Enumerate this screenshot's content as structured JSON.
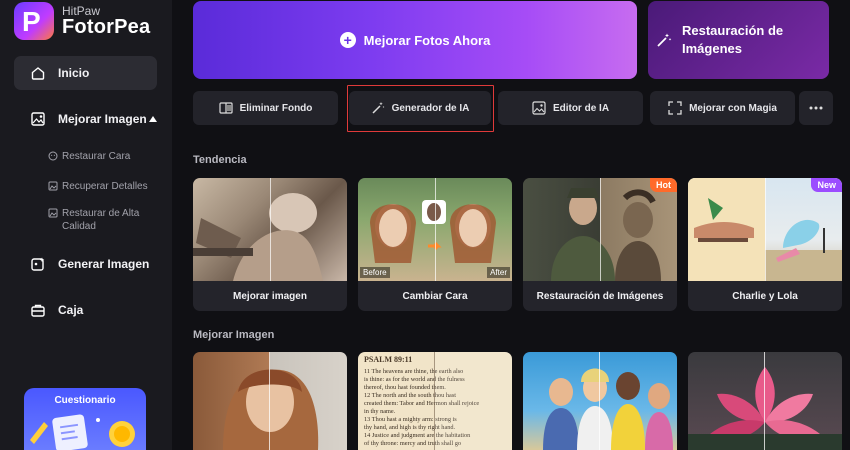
{
  "app": {
    "brand_top": "HitPaw",
    "brand_name": "FotorPea"
  },
  "sidebar": {
    "home": "Inicio",
    "enhance": "Mejorar Imagen",
    "enhance_sub": [
      "Restaurar Cara",
      "Recuperar Detalles",
      "Restaurar de Alta Calidad"
    ],
    "generate": "Generar Imagen",
    "box": "Caja",
    "promo": "Cuestionario"
  },
  "hero": {
    "enhance_now": "Mejorar Fotos Ahora",
    "restore": "Restauración de Imágenes"
  },
  "tools": [
    "Eliminar Fondo",
    "Generador de IA",
    "Editor de IA",
    "Mejorar con Magia"
  ],
  "sections": {
    "trending": "Tendencia",
    "enhance": "Mejorar Imagen"
  },
  "trending_cards": [
    {
      "caption": "Mejorar imagen"
    },
    {
      "caption": "Cambiar Cara",
      "before": "Before",
      "after": "After"
    },
    {
      "caption": "Restauración de Imágenes",
      "badge": "Hot"
    },
    {
      "caption": "Charlie y Lola",
      "badge": "New"
    }
  ],
  "enhance_cards": [
    {
      "name": "portrait"
    },
    {
      "name": "bible-text",
      "text_lines": [
        "PSALM 89:11",
        "11 The heavens are thine, the earth also",
        "is thine: as for the world and the fulness",
        "thereof, thou hast founded them.",
        "12 The north and the south thou hast",
        "created them: Tabor and Hermon shall rejoice",
        "in thy name.",
        "13 Thou hast a mighty arm: strong is",
        "thy hand, and high is thy right hand.",
        "14 Justice and judgment are the habitation",
        "of thy throne: mercy and truth shall go"
      ]
    },
    {
      "name": "group-photo"
    },
    {
      "name": "lotus"
    }
  ],
  "colors": {
    "accent": "#7d3cf0",
    "highlight": "#e03a3a",
    "hot": "#ff6a2a",
    "new": "#9b4cff"
  }
}
